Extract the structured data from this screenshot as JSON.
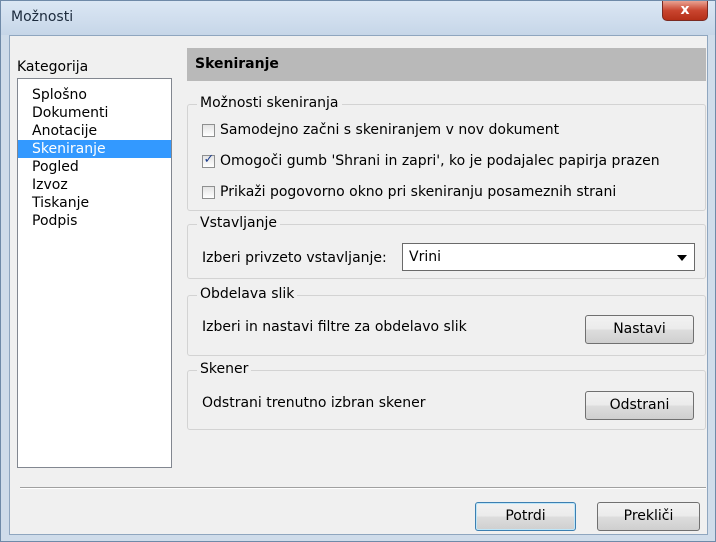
{
  "window": {
    "title": "Možnosti",
    "close_label": "x"
  },
  "sidebar": {
    "label": "Kategorija",
    "items": [
      {
        "label": "Splošno"
      },
      {
        "label": "Dokumenti"
      },
      {
        "label": "Anotacije"
      },
      {
        "label": "Skeniranje",
        "selected": true
      },
      {
        "label": "Pogled"
      },
      {
        "label": "Izvoz"
      },
      {
        "label": "Tiskanje"
      },
      {
        "label": "Podpis"
      }
    ]
  },
  "main": {
    "header": "Skeniranje",
    "scan_options": {
      "title": "Možnosti skeniranja",
      "options": [
        {
          "label": "Samodejno začni s skeniranjem v nov dokument",
          "checked": false
        },
        {
          "label": "Omogoči gumb 'Shrani in zapri', ko je podajalec papirja prazen",
          "checked": true
        },
        {
          "label": "Prikaži pogovorno okno pri skeniranju posameznih strani",
          "checked": false
        }
      ]
    },
    "insert": {
      "title": "Vstavljanje",
      "label": "Izberi privzeto vstavljanje:",
      "selected": "Vrini"
    },
    "image_processing": {
      "title": "Obdelava slik",
      "label": "Izberi in nastavi filtre za obdelavo slik",
      "button": "Nastavi"
    },
    "scanner": {
      "title": "Skener",
      "label": "Odstrani trenutno izbran skener",
      "button": "Odstrani"
    }
  },
  "footer": {
    "ok": "Potrdi",
    "cancel": "Prekliči"
  },
  "colors": {
    "selection": "#3399ff",
    "header_bg": "#b9b9b9",
    "close_red": "#c9452f"
  }
}
